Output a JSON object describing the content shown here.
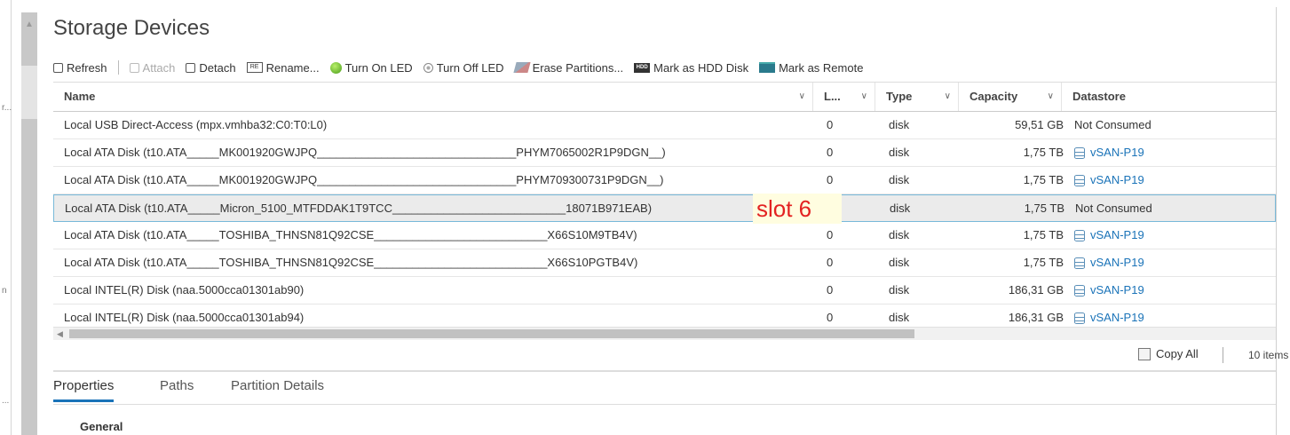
{
  "page": {
    "title": "Storage Devices"
  },
  "gutter": {
    "marks": [
      "r...",
      "n",
      "..."
    ]
  },
  "toolbar": {
    "refresh": "Refresh",
    "attach": "Attach",
    "detach": "Detach",
    "rename": "Rename...",
    "turn_on_led": "Turn On LED",
    "turn_off_led": "Turn Off LED",
    "erase_partitions": "Erase Partitions...",
    "mark_hdd": "Mark as HDD Disk",
    "mark_remote": "Mark as Remote",
    "rename_icon_text": "RE",
    "hdd_icon_text": "HDD"
  },
  "grid": {
    "columns": {
      "name": "Name",
      "lun": "L...",
      "type": "Type",
      "capacity": "Capacity",
      "datastore": "Datastore"
    },
    "rows": [
      {
        "name": "Local USB Direct-Access (mpx.vmhba32:C0:T0:L0)",
        "lun": "0",
        "type": "disk",
        "capacity": "59,51 GB",
        "datastore": "Not Consumed",
        "ds_link": false
      },
      {
        "name": "Local ATA Disk (t10.ATA_____MK001920GWJPQ_______________________________PHYM7065002R1P9DGN__)",
        "lun": "0",
        "type": "disk",
        "capacity": "1,75 TB",
        "datastore": "vSAN-P19",
        "ds_link": true
      },
      {
        "name": "Local ATA Disk (t10.ATA_____MK001920GWJPQ_______________________________PHYM709300731P9DGN__)",
        "lun": "0",
        "type": "disk",
        "capacity": "1,75 TB",
        "datastore": "vSAN-P19",
        "ds_link": true
      },
      {
        "name": "Local ATA Disk (t10.ATA_____Micron_5100_MTFDDAK1T9TCC___________________________18071B971EAB)",
        "lun": "0",
        "type": "disk",
        "capacity": "1,75 TB",
        "datastore": "Not Consumed",
        "ds_link": false,
        "selected": true
      },
      {
        "name": "Local ATA Disk (t10.ATA_____TOSHIBA_THNSN81Q92CSE___________________________X66S10M9TB4V)",
        "lun": "0",
        "type": "disk",
        "capacity": "1,75 TB",
        "datastore": "vSAN-P19",
        "ds_link": true
      },
      {
        "name": "Local ATA Disk (t10.ATA_____TOSHIBA_THNSN81Q92CSE___________________________X66S10PGTB4V)",
        "lun": "0",
        "type": "disk",
        "capacity": "1,75 TB",
        "datastore": "vSAN-P19",
        "ds_link": true
      },
      {
        "name": "Local INTEL(R) Disk (naa.5000cca01301ab90)",
        "lun": "0",
        "type": "disk",
        "capacity": "186,31 GB",
        "datastore": "vSAN-P19",
        "ds_link": true
      },
      {
        "name": "Local INTEL(R) Disk (naa.5000cca01301ab94)",
        "lun": "0",
        "type": "disk",
        "capacity": "186,31 GB",
        "datastore": "vSAN-P19",
        "ds_link": true
      }
    ]
  },
  "annotation": {
    "text": "slot 6",
    "color": "#e32222"
  },
  "footer": {
    "copy_all": "Copy All",
    "item_count": "10 items"
  },
  "tabs": [
    {
      "label": "Properties",
      "active": true
    },
    {
      "label": "Paths",
      "active": false
    },
    {
      "label": "Partition Details",
      "active": false
    }
  ],
  "details": {
    "section_title": "General"
  },
  "colors": {
    "accent": "#1a73b8",
    "selection_border": "#78b9d9",
    "selection_bg": "#ebebeb"
  }
}
